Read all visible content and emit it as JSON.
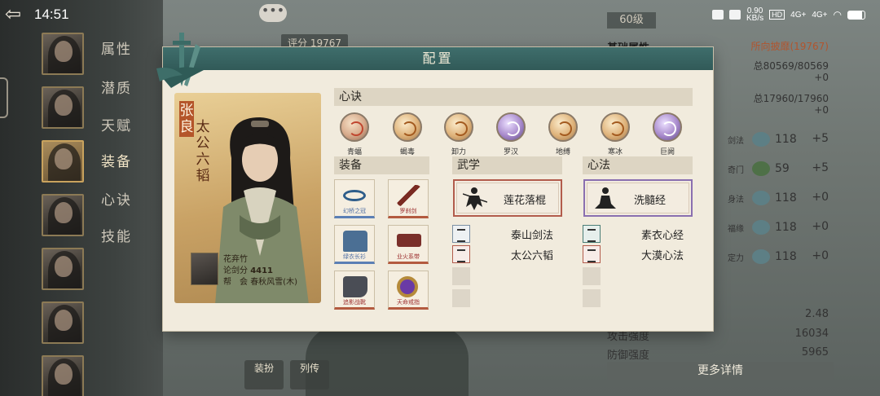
{
  "status_bar": {
    "time": "14:51",
    "net_speed_top": "0.90",
    "net_speed_unit": "KB/s",
    "hd": "HD",
    "signal1": "4G+",
    "signal2": "4G+"
  },
  "background": {
    "score_chip": "评分 19767",
    "level_chip": "60级",
    "chat_icon": "•••",
    "side_tabs": [
      "属性",
      "潜质",
      "天赋",
      "装备",
      "心诀",
      "技能"
    ],
    "active_side_tab": "装备",
    "stats": {
      "heading": "基础属性",
      "heading_right": "所向披靡(19767)",
      "hp_line": "总80569/80569",
      "hp_plus": "+0",
      "mp_line": "总17960/17960",
      "mp_plus": "+0",
      "rows": [
        {
          "label": "剑法",
          "value": "118",
          "plus": "+5"
        },
        {
          "label": "奇门",
          "value": "59",
          "plus": "+5"
        },
        {
          "label": "身法",
          "value": "118",
          "plus": "+0"
        },
        {
          "label": "福缘",
          "value": "118",
          "plus": "+0"
        },
        {
          "label": "定力",
          "value": "118",
          "plus": "+0"
        }
      ],
      "small": [
        {
          "label": "",
          "value": "2.48"
        },
        {
          "label": "攻击强度",
          "value": "16034"
        },
        {
          "label": "防御强度",
          "value": "5965"
        }
      ],
      "more_button": "更多详情"
    },
    "scene_buttons": [
      "装扮",
      "列传"
    ]
  },
  "modal": {
    "title": "配置",
    "character": {
      "name": "张良",
      "title": "太公六韬",
      "nickname": "花弃竹",
      "score_label": "论剑分",
      "score_value": "4411",
      "guild_label": "帮　会",
      "guild_value": "春秋风雪(木)"
    },
    "xinjue_header": "心诀",
    "xinjue": [
      {
        "name": "青蝠",
        "style": "normal"
      },
      {
        "name": "蝎毒",
        "style": "gold"
      },
      {
        "name": "卸力",
        "style": "gold"
      },
      {
        "name": "罗汉",
        "style": "purple"
      },
      {
        "name": "地缚",
        "style": "gold"
      },
      {
        "name": "寒冰",
        "style": "gold"
      },
      {
        "name": "巨阙",
        "style": "purple"
      }
    ],
    "equip_header": "装备",
    "equipment": [
      {
        "name": "幻桥之冠",
        "quality": "blue"
      },
      {
        "name": "罗刹剑",
        "quality": "red"
      },
      {
        "name": "绿衣长衫",
        "quality": "blue"
      },
      {
        "name": "业火系带",
        "quality": "red"
      },
      {
        "name": "追影战靴",
        "quality": "red"
      },
      {
        "name": "天命戒指",
        "quality": "red"
      }
    ],
    "wuxue_header": "武学",
    "wuxue_main": "莲花落棍",
    "wuxue_sub": [
      "泰山剑法",
      "太公六韬"
    ],
    "xinfa_header": "心法",
    "xinfa_main": "洗髓经",
    "xinfa_sub": [
      "素衣心经",
      "大漠心法"
    ]
  },
  "colors": {
    "header_teal": "#3f6e6c",
    "panel_bg": "#f1ebdd",
    "red_frame": "#b25c4c",
    "purple_frame": "#8a6fb0"
  }
}
